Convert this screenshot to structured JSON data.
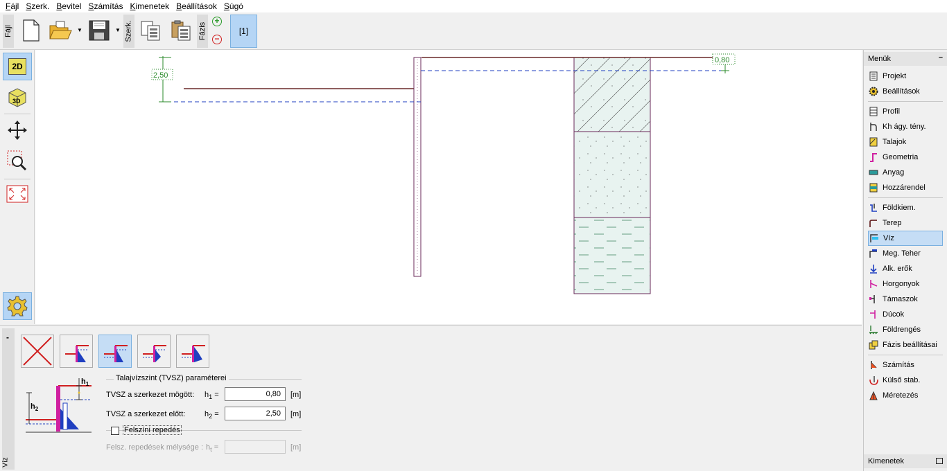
{
  "menu": [
    {
      "u": "F",
      "rest": "ájl"
    },
    {
      "u": "S",
      "rest": "zerk."
    },
    {
      "u": "B",
      "rest": "evitel"
    },
    {
      "u": "S",
      "rest": "zámítás"
    },
    {
      "u": "K",
      "rest": "imenetek"
    },
    {
      "u": "B",
      "rest": "eállítások"
    },
    {
      "u": "S",
      "rest": "úgó"
    }
  ],
  "toolbar": {
    "group_file": "Fájl",
    "group_edit": "Szerk.",
    "group_phase": "Fázis",
    "phase_label": "[1]"
  },
  "left_tools": {
    "btn_2d": "2D",
    "btn_3d": "3D"
  },
  "canvas": {
    "dim_left": "2,50",
    "dim_right": "0,80"
  },
  "right_panel": {
    "header": "Menük",
    "footer": "Kimenetek",
    "items": [
      {
        "label": "Projekt",
        "icon": "document-icon"
      },
      {
        "label": "Beállítások",
        "icon": "gear-icon"
      },
      {
        "label": "Profil",
        "icon": "profile-icon"
      },
      {
        "label": "Kh ágy. tény.",
        "icon": "subgrade-icon"
      },
      {
        "label": "Talajok",
        "icon": "soils-icon"
      },
      {
        "label": "Geometria",
        "icon": "geometry-icon"
      },
      {
        "label": "Anyag",
        "icon": "material-icon"
      },
      {
        "label": "Hozzárendel",
        "icon": "assign-icon"
      },
      {
        "label": "Földkiem.",
        "icon": "excavation-icon"
      },
      {
        "label": "Terep",
        "icon": "terrain-icon"
      },
      {
        "label": "Víz",
        "icon": "water-icon"
      },
      {
        "label": "Meg. Teher",
        "icon": "surcharge-icon"
      },
      {
        "label": "Alk. erők",
        "icon": "applied-forces-icon"
      },
      {
        "label": "Horgonyok",
        "icon": "anchors-icon"
      },
      {
        "label": "Támaszok",
        "icon": "supports-icon"
      },
      {
        "label": "Dúcok",
        "icon": "props-icon"
      },
      {
        "label": "Földrengés",
        "icon": "earthquake-icon"
      },
      {
        "label": "Fázis beállításai",
        "icon": "phase-settings-icon"
      },
      {
        "label": "Számítás",
        "icon": "analysis-icon"
      },
      {
        "label": "Külső stab.",
        "icon": "external-stability-icon"
      },
      {
        "label": "Méretezés",
        "icon": "dimensioning-icon"
      }
    ]
  },
  "bottom_panel": {
    "side_label": "Víz",
    "group_title": "Talajvízszint (TVSZ) paraméterei",
    "row1_label": "TVSZ a szerkezet mögött:",
    "row1_sym": "h",
    "row1_sub": "1",
    "row1_eq": " =",
    "row1_value": "0,80",
    "row1_unit": "[m]",
    "row2_label": "TVSZ a szerkezet előtt:",
    "row2_sym": "h",
    "row2_sub": "2",
    "row2_eq": " =",
    "row2_value": "2,50",
    "row2_unit": "[m]",
    "checkbox_label": "Felszíni repedés",
    "row3_label": "Felsz. repedések mélysége :",
    "row3_sym": "h",
    "row3_sub": "t",
    "row3_eq": " =",
    "row3_value": "",
    "row3_unit": "[m]",
    "diagram_h1": "h",
    "diagram_h1_sub": "1",
    "diagram_h2": "h",
    "diagram_h2_sub": "2"
  },
  "colors": {
    "accent": "#b5d5f5",
    "water_line": "#1f3fc0",
    "wall": "#6a2a5a",
    "dimension": "#2a8a2a"
  }
}
